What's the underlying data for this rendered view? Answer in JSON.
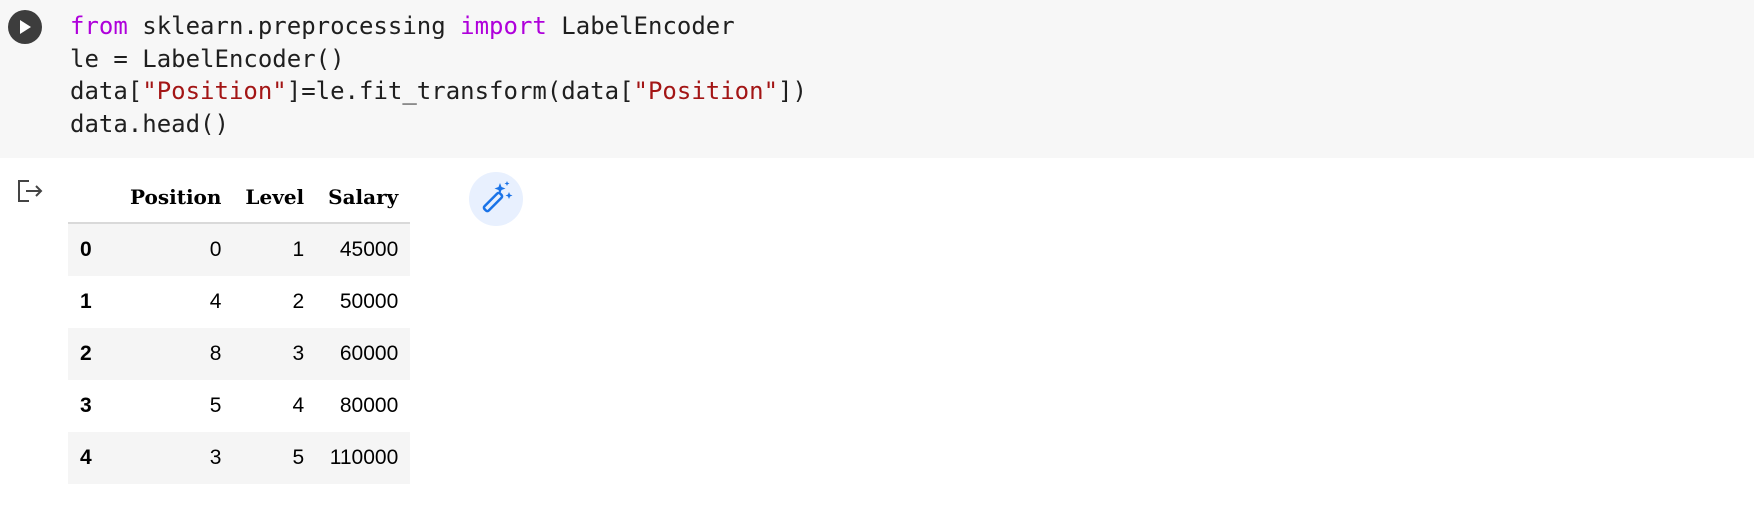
{
  "code_cell": {
    "lines": [
      [
        {
          "t": "from",
          "c": "kw"
        },
        {
          "t": " sklearn.preprocessing ",
          "c": ""
        },
        {
          "t": "import",
          "c": "kw"
        },
        {
          "t": " LabelEncoder",
          "c": ""
        }
      ],
      [
        {
          "t": "le = LabelEncoder()",
          "c": ""
        }
      ],
      [
        {
          "t": "data[",
          "c": ""
        },
        {
          "t": "\"Position\"",
          "c": "str"
        },
        {
          "t": "]=le.fit_transform(data[",
          "c": ""
        },
        {
          "t": "\"Position\"",
          "c": "str"
        },
        {
          "t": "])",
          "c": ""
        }
      ],
      [
        {
          "t": "data.head()",
          "c": ""
        }
      ]
    ]
  },
  "icons": {
    "run": "play-icon",
    "output": "output-arrow-icon",
    "suggest": "magic-wand-icon"
  },
  "dataframe": {
    "columns": [
      "Position",
      "Level",
      "Salary"
    ],
    "rows": [
      {
        "index": "0",
        "values": [
          "0",
          "1",
          "45000"
        ]
      },
      {
        "index": "1",
        "values": [
          "4",
          "2",
          "50000"
        ]
      },
      {
        "index": "2",
        "values": [
          "8",
          "3",
          "60000"
        ]
      },
      {
        "index": "3",
        "values": [
          "5",
          "4",
          "80000"
        ]
      },
      {
        "index": "4",
        "values": [
          "3",
          "5",
          "110000"
        ]
      }
    ]
  },
  "colors": {
    "keyword": "#af00db",
    "string": "#a31515",
    "cell_bg": "#f7f7f7",
    "accent": "#1a73e8"
  }
}
